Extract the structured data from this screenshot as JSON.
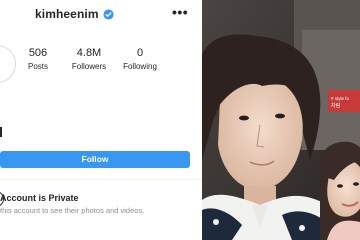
{
  "profile": {
    "username": "kimheenim",
    "stats": [
      {
        "value": "506",
        "label": "Posts"
      },
      {
        "value": "4.8M",
        "label": "Followers"
      },
      {
        "value": "0",
        "label": "Following"
      }
    ],
    "follow_label": "Follow",
    "private_title": "Account is Private",
    "private_sub": "this account to see their photos and videos."
  },
  "icons": {
    "verified": "verified-badge-icon",
    "more": "more-options-icon",
    "lock": "lock-icon"
  },
  "colors": {
    "accent": "#3897f0",
    "text": "#262626",
    "muted": "#8e8e8e"
  },
  "photo": {
    "sign_text": "# style fo",
    "sign_text2": "차림"
  }
}
